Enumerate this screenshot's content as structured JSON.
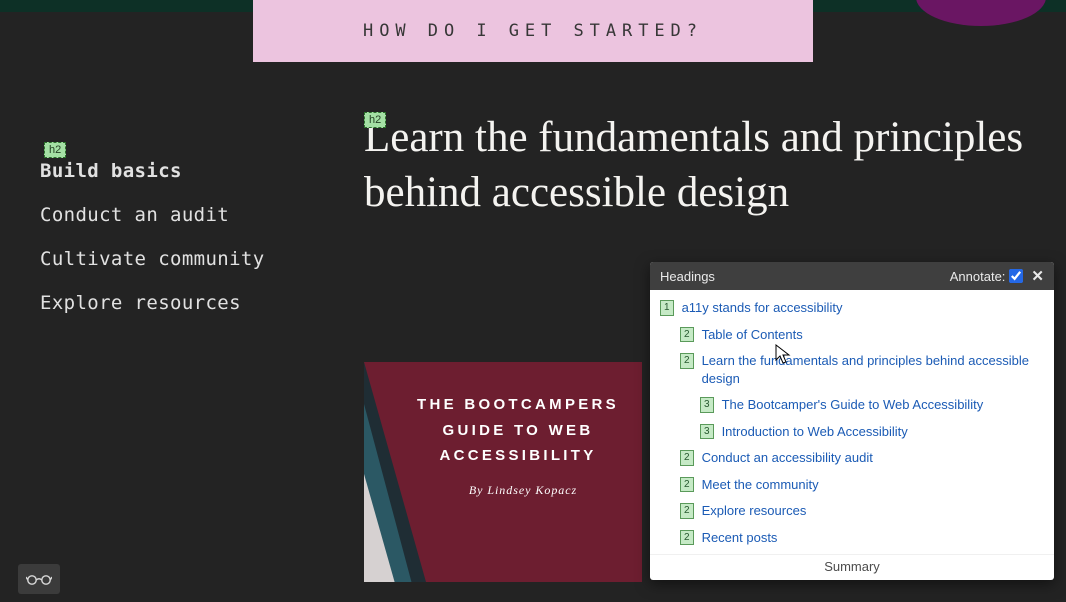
{
  "banner": {
    "cta": "HOW DO I GET STARTED?"
  },
  "heading_tag_label": "h2",
  "sidebar": {
    "items": [
      {
        "label": "Build basics"
      },
      {
        "label": "Conduct an audit"
      },
      {
        "label": "Cultivate community"
      },
      {
        "label": "Explore resources"
      }
    ]
  },
  "main": {
    "heading": "Learn the fundamentals and principles behind accessible design"
  },
  "book": {
    "title": "THE BOOTCAMPERS GUIDE TO WEB ACCESSIBILITY",
    "author": "By Lindsey Kopacz"
  },
  "panel": {
    "title": "Headings",
    "annotate_label": "Annotate:",
    "annotate_checked": true,
    "close_glyph": "✕",
    "summary_label": "Summary",
    "items": [
      {
        "level": 1,
        "text": "a11y stands for accessibility"
      },
      {
        "level": 2,
        "text": "Table of Contents"
      },
      {
        "level": 2,
        "text": "Learn the fundamentals and principles behind accessible design"
      },
      {
        "level": 3,
        "text": "The Bootcamper's Guide to Web Accessibility"
      },
      {
        "level": 3,
        "text": "Introduction to Web Accessibility"
      },
      {
        "level": 2,
        "text": "Conduct an accessibility audit"
      },
      {
        "level": 2,
        "text": "Meet the community"
      },
      {
        "level": 2,
        "text": "Explore resources"
      },
      {
        "level": 2,
        "text": "Recent posts"
      }
    ]
  }
}
